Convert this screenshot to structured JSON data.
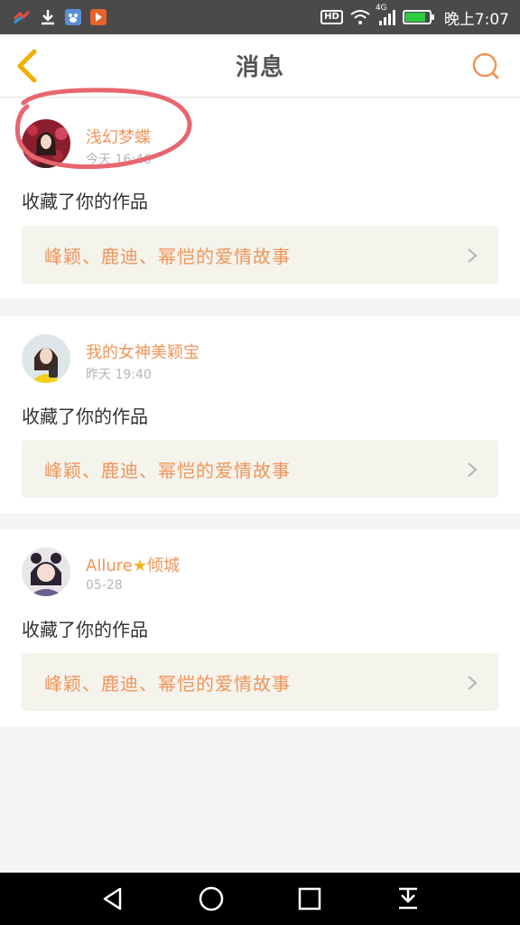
{
  "status_bar": {
    "time": "晚上7:07",
    "hd": "HD",
    "network": "4G",
    "icons_left": [
      "app-icon",
      "download-icon",
      "baidu-icon",
      "video-icon"
    ],
    "icons_right": [
      "hd-icon",
      "wifi-icon",
      "signal-icon",
      "battery-icon"
    ]
  },
  "header": {
    "title": "消息",
    "back_icon": "chevron-left-icon",
    "search_icon": "search-icon",
    "accent_color": "#f0955a"
  },
  "messages": [
    {
      "username": "浅幻梦蝶",
      "timestamp": "今天 16:46",
      "action": "收藏了你的作品",
      "work_title": "峰颖、鹿迪、幂恺的爱情故事",
      "annotated": true
    },
    {
      "username": "我的女神美颖宝",
      "timestamp": "昨天 19:40",
      "action": "收藏了你的作品",
      "work_title": "峰颖、鹿迪、幂恺的爱情故事"
    },
    {
      "username_prefix": "Allure",
      "username_star": "★",
      "username_suffix": "倾城",
      "timestamp": "05-28",
      "action": "收藏了你的作品",
      "work_title": "峰颖、鹿迪、幂恺的爱情故事"
    }
  ],
  "nav_bar": {
    "buttons": [
      "back-triangle-icon",
      "home-circle-icon",
      "recents-square-icon",
      "notification-pull-icon"
    ]
  }
}
